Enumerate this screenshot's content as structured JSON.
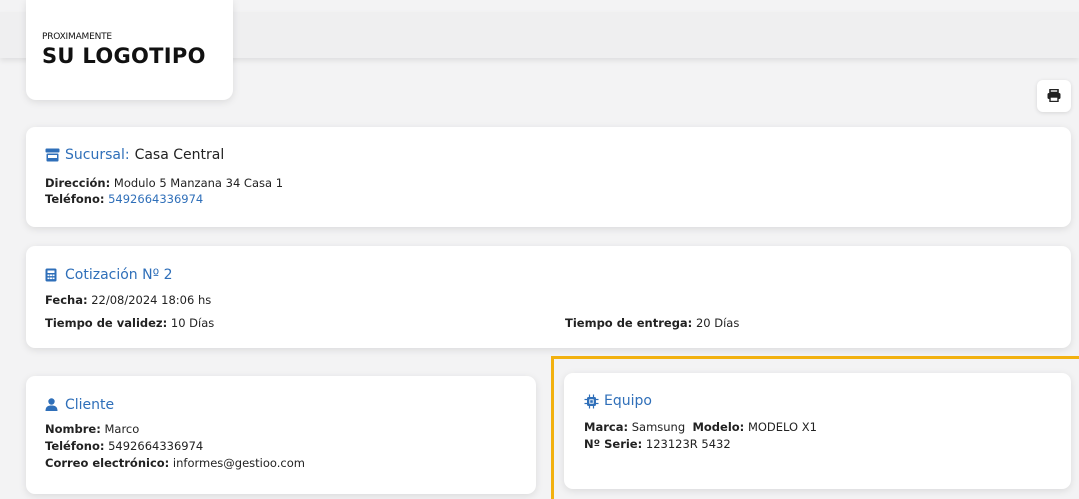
{
  "logo": {
    "small": "PROXIMAMENTE",
    "big": "SU LOGOTIPO"
  },
  "print_icon": "printer-icon",
  "branch": {
    "icon": "store-icon",
    "label": "Sucursal:",
    "name": "Casa Central",
    "address_label": "Dirección:",
    "address": "Modulo 5 Manzana 34 Casa 1",
    "phone_label": "Teléfono:",
    "phone": "5492664336974"
  },
  "quote": {
    "icon": "calculator-icon",
    "title": "Cotización Nº 2",
    "date_label": "Fecha:",
    "date": "22/08/2024 18:06 hs",
    "validity_label": "Tiempo de validez:",
    "validity": "10 Días",
    "delivery_label": "Tiempo de entrega:",
    "delivery": "20 Días"
  },
  "client": {
    "icon": "user-icon",
    "title": "Cliente",
    "name_label": "Nombre:",
    "name": "Marco",
    "phone_label": "Teléfono:",
    "phone": "5492664336974",
    "email_label": "Correo electrónico:",
    "email": "informes@gestioo.com"
  },
  "equipment": {
    "icon": "chip-icon",
    "title": "Equipo",
    "brand_label": "Marca:",
    "brand": "Samsung",
    "model_label": "Modelo:",
    "model": "MODELO X1",
    "serial_label": "Nº Serie:",
    "serial": "123123R 5432"
  },
  "colors": {
    "accent": "#2f6fb9",
    "highlight": "#f2b10f",
    "background": "#f3f3f4"
  }
}
